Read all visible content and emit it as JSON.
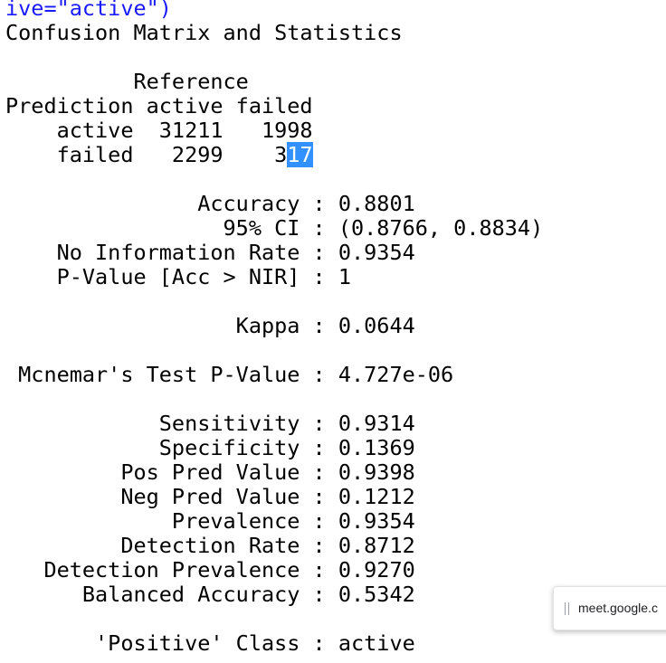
{
  "command_tail": "ive=\"active\")",
  "output_title": "Confusion Matrix and Statistics",
  "matrix": {
    "reference_header": "          Reference",
    "prediction_header": "Prediction active failed",
    "row_active": "    active  31211   1998",
    "row_failed_prefix": "    failed   2299    3",
    "row_failed_selected": "17"
  },
  "stats": [
    "               Accuracy : 0.8801",
    "                 95% CI : (0.8766, 0.8834)",
    "    No Information Rate : 0.9354",
    "    P-Value [Acc > NIR] : 1",
    "                  Kappa : 0.0644",
    " Mcnemar's Test P-Value : 4.727e-06",
    "            Sensitivity : 0.9314",
    "            Specificity : 0.1369",
    "         Pos Pred Value : 0.9398",
    "         Neg Pred Value : 0.1212",
    "             Prevalence : 0.9354",
    "         Detection Rate : 0.8712",
    "   Detection Prevalence : 0.9270",
    "      Balanced Accuracy : 0.5342",
    "       'Positive' Class : active"
  ],
  "screen_share_popup": {
    "text": "meet.google.c"
  },
  "colors": {
    "command": "#1a1aff",
    "selection": "#3390ff"
  }
}
